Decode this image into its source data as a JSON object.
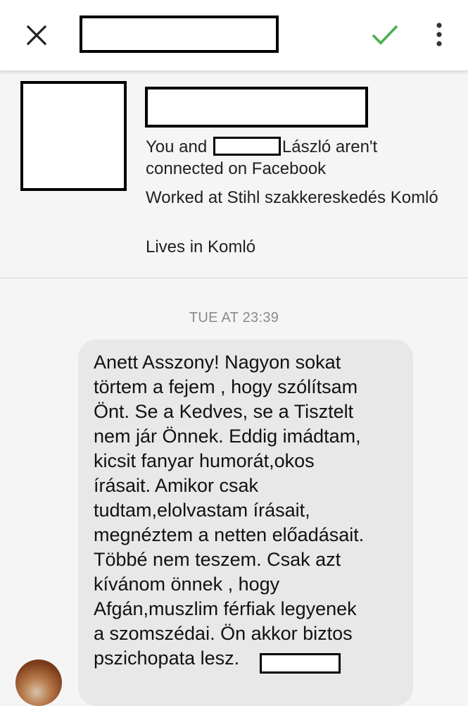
{
  "header": {
    "close_icon": "close-icon",
    "accept_icon": "check-icon",
    "more_icon": "more-vert-icon",
    "accent_color": "#4caf50"
  },
  "profile": {
    "connection_before": "You and ",
    "connection_after": "László aren't connected on Facebook",
    "work": "Worked at Stihl szakkereskedés Komló",
    "lives": "Lives in Komló"
  },
  "conversation": {
    "timestamp": "TUE AT 23:39",
    "message_text": "Anett Asszony!  Nagyon sokat\ntörtem a fejem , hogy szólítsam\nÖnt. Se a Kedves, se a Tisztelt\nnem jár Önnek. Eddig imádtam,\nkicsit fanyar humorát,okos\nírásait. Amikor csak\ntudtam,elolvastam írásait,\nmegnéztem a netten előadásait.\nTöbbé nem teszem. Csak azt\nkívánom önnek , hogy\nAfgán,muszlim férfiak legyenek\na szomszédai. Ön akkor biztos\npszichopata lesz."
  }
}
